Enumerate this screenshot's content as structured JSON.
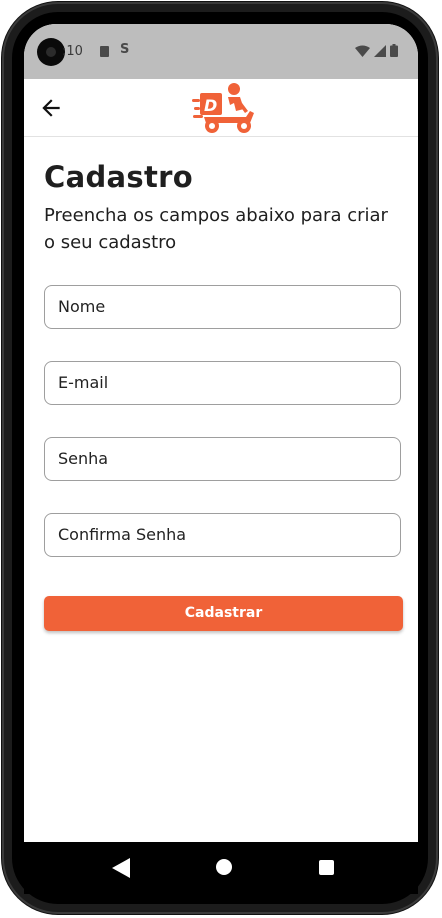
{
  "status_bar": {
    "time": ":10",
    "icons": [
      "sd-card-icon",
      "s-icon",
      "wifi-icon",
      "signal-icon",
      "battery-icon"
    ]
  },
  "app_bar": {
    "back_icon": "arrow-left-icon",
    "logo_letter": "D"
  },
  "page": {
    "title": "Cadastro",
    "subtitle": "Preencha os campos abaixo para criar o seu cadastro"
  },
  "form": {
    "fields": [
      {
        "placeholder": "Nome"
      },
      {
        "placeholder": "E-mail"
      },
      {
        "placeholder": "Senha"
      },
      {
        "placeholder": "Confirma Senha"
      }
    ],
    "submit_label": "Cadastrar"
  },
  "colors": {
    "accent": "#f06238",
    "status_bar": "#bdbdbd",
    "text": "#1f1f1f",
    "field_border": "#9e9e9e"
  },
  "nav_bar": {
    "icons": [
      "back-triangle-icon",
      "home-circle-icon",
      "recents-square-icon"
    ]
  }
}
